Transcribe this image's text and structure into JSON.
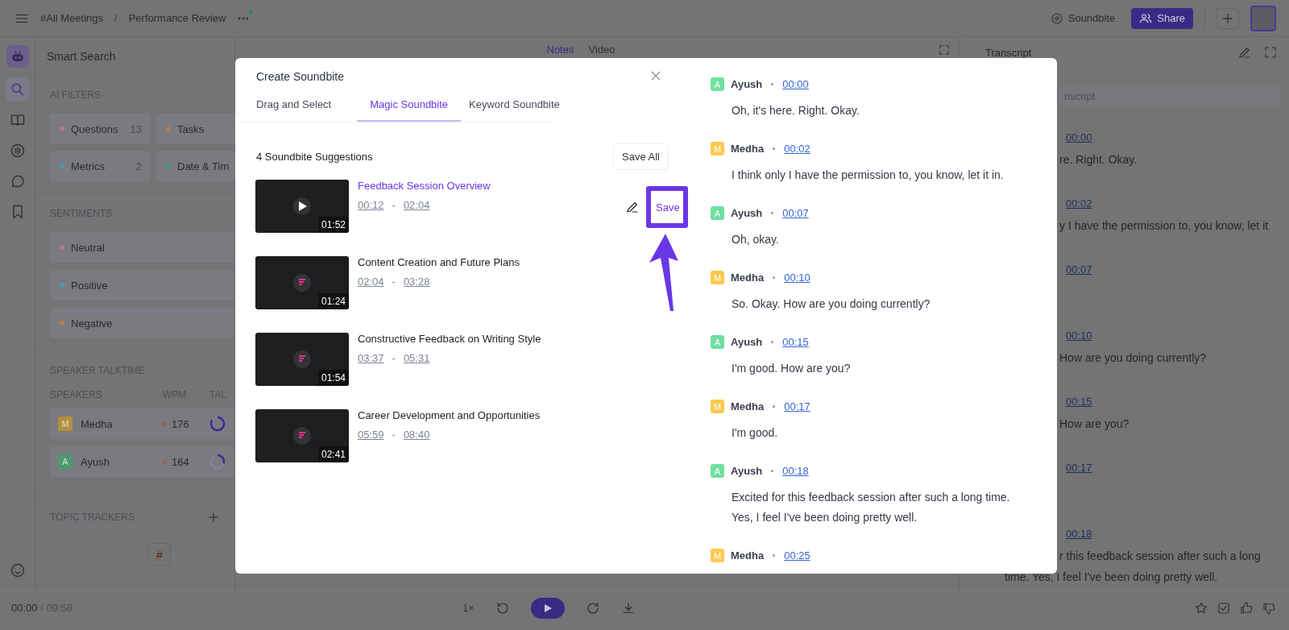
{
  "topbar": {
    "breadcrumb": [
      "#All Meetings",
      "Performance Review"
    ],
    "separator": "/",
    "soundbite_button": "Soundbite",
    "share_button": "Share"
  },
  "rail": {
    "items": [
      {
        "kind": "search",
        "selected": true
      },
      {
        "kind": "book",
        "selected": false
      },
      {
        "kind": "soundwave",
        "selected": false
      },
      {
        "kind": "chat",
        "selected": false
      },
      {
        "kind": "bookmark",
        "selected": false
      }
    ]
  },
  "smart_search": {
    "title": "Smart Search",
    "ai_filters": {
      "heading": "AI FILTERS",
      "chips": [
        {
          "label": "Questions",
          "count": "13",
          "color": "#b5739a"
        },
        {
          "label": "Tasks",
          "color": "#b57d52"
        },
        {
          "label": "Metrics",
          "count": "2",
          "color": "#4d9aab"
        },
        {
          "label": "Date & Tim",
          "color": "#3f9c8f"
        }
      ]
    },
    "sentiments": {
      "heading": "SENTIMENTS",
      "items": [
        {
          "label": "Neutral",
          "color": "#b5739a"
        },
        {
          "label": "Positive",
          "color": "#4d9aab"
        },
        {
          "label": "Negative",
          "color": "#b57d52"
        }
      ]
    },
    "talktime": {
      "heading": "SPEAKER TALKTIME",
      "columns": [
        "SPEAKERS",
        "WPM",
        "TAL"
      ],
      "speakers": [
        {
          "initial": "M",
          "name": "Medha",
          "wpm": "176",
          "color": "#b3913a",
          "level": 0.85
        },
        {
          "initial": "A",
          "name": "Ayush",
          "wpm": "164",
          "color": "#4f9a6c",
          "level": 0.3
        }
      ]
    },
    "topic_trackers": {
      "heading": "TOPIC TRACKERS"
    },
    "hash_button": "#"
  },
  "center": {
    "tabs": [
      {
        "label": "Notes",
        "selected": true
      },
      {
        "label": "Video",
        "selected": false
      }
    ]
  },
  "transcript_panel": {
    "title": "Transcript",
    "search_placeholder": "nscript",
    "entries": [
      {
        "time": "00:00",
        "lines": [
          "re. Right. Okay."
        ]
      },
      {
        "time": "00:02",
        "lines": [
          "y I have the permission to, you know, let it"
        ]
      },
      {
        "time": "00:07"
      },
      {
        "time": "00:10",
        "lines": [
          "How are you doing currently?"
        ]
      },
      {
        "time": "00:15",
        "lines": [
          "How are you?"
        ]
      },
      {
        "time": "00:17"
      },
      {
        "time": "00:18",
        "lines": [
          "r this feedback session after such a long",
          "time. Yes, I feel I've been doing pretty well."
        ]
      }
    ]
  },
  "modal": {
    "title": "Create Soundbite",
    "tabs": [
      {
        "label": "Drag and Select",
        "selected": false
      },
      {
        "label": "Magic Soundbite",
        "selected": true
      },
      {
        "label": "Keyword Soundbite",
        "selected": false
      }
    ],
    "suggestions_heading": "4 Soundbite Suggestions",
    "range_separator": "-",
    "save_all_button": "Save All",
    "suggestions": [
      {
        "title": "Feedback Session Overview",
        "start": "00:12",
        "end": "02:04",
        "duration": "01:52",
        "selected": true,
        "save_button": "Save",
        "highlighted": true
      },
      {
        "title": "Content Creation and Future Plans",
        "start": "02:04",
        "end": "03:28",
        "duration": "01:24",
        "selected": false
      },
      {
        "title": "Constructive Feedback on Writing Style",
        "start": "03:37",
        "end": "05:31",
        "duration": "01:54",
        "selected": false
      },
      {
        "title": "Career Development and Opportunities",
        "start": "05:59",
        "end": "08:40",
        "duration": "02:41",
        "selected": false
      }
    ],
    "transcript": [
      {
        "initial": "A",
        "speaker": "Ayush",
        "color": "#6ee0a0",
        "time": "00:00",
        "text": "Oh, it's here. Right. Okay."
      },
      {
        "initial": "M",
        "speaker": "Medha",
        "color": "#fcc94d",
        "time": "00:02",
        "text": "I think only I have the permission to, you know, let it in."
      },
      {
        "initial": "A",
        "speaker": "Ayush",
        "color": "#6ee0a0",
        "time": "00:07",
        "text": "Oh, okay."
      },
      {
        "initial": "M",
        "speaker": "Medha",
        "color": "#fcc94d",
        "time": "00:10",
        "text": "So. Okay. How are you doing currently?"
      },
      {
        "initial": "A",
        "speaker": "Ayush",
        "color": "#6ee0a0",
        "time": "00:15",
        "text": "I'm good. How are you?"
      },
      {
        "initial": "M",
        "speaker": "Medha",
        "color": "#fcc94d",
        "time": "00:17",
        "text": "I'm good."
      },
      {
        "initial": "A",
        "speaker": "Ayush",
        "color": "#6ee0a0",
        "time": "00:18",
        "text": "Excited for this feedback session after such a long time. Yes, I feel I've been doing pretty well."
      },
      {
        "initial": "M",
        "speaker": "Medha",
        "color": "#fcc94d",
        "time": "00:25"
      }
    ]
  },
  "player": {
    "elapsed": "00:00",
    "separator": "/",
    "duration": "09:58",
    "speed": "1×"
  }
}
